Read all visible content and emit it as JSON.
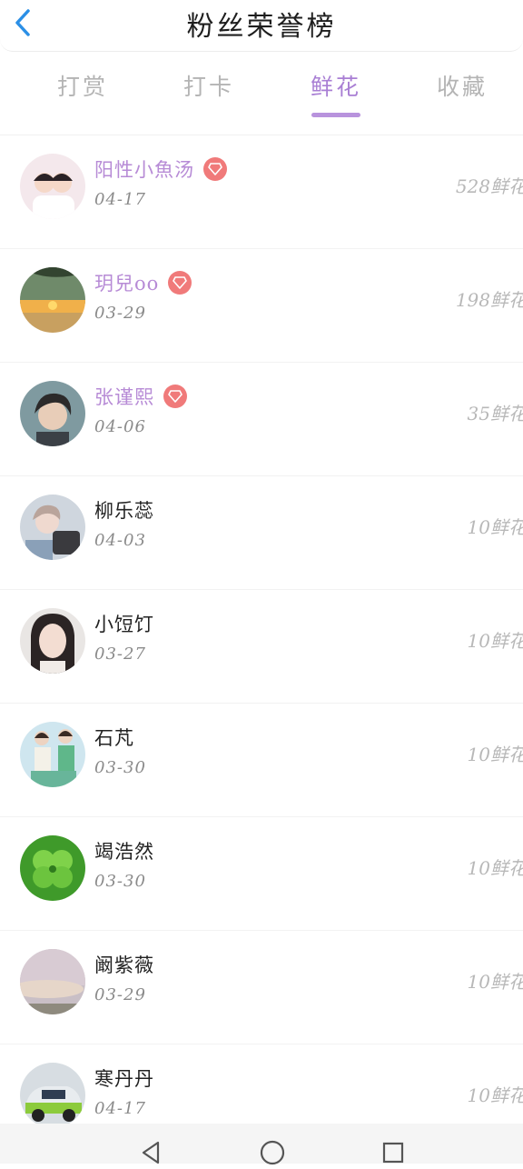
{
  "header": {
    "title": "粉丝荣誉榜",
    "back_icon": "chevron-left-icon",
    "accent": "#2b8fe6"
  },
  "tabs": [
    {
      "label": "打赏",
      "active": false
    },
    {
      "label": "打卡",
      "active": false
    },
    {
      "label": "鲜花",
      "active": true
    },
    {
      "label": "收藏",
      "active": false
    }
  ],
  "colors": {
    "active_tab": "#a97fd4",
    "vip_name": "#b78bd6",
    "badge": "#f07a7a",
    "inactive": "#b4b4b4"
  },
  "rows": [
    {
      "name": "阳性小魚汤",
      "date": "04-17",
      "flowers": "528鲜花",
      "vip": true
    },
    {
      "name": "玥兒oo",
      "date": "03-29",
      "flowers": "198鲜花",
      "vip": true
    },
    {
      "name": "张谨熙",
      "date": "04-06",
      "flowers": "35鲜花",
      "vip": true
    },
    {
      "name": "柳乐蕊",
      "date": "04-03",
      "flowers": "10鲜花",
      "vip": false
    },
    {
      "name": "小饾饤",
      "date": "03-27",
      "flowers": "10鲜花",
      "vip": false
    },
    {
      "name": "石芃",
      "date": "03-30",
      "flowers": "10鲜花",
      "vip": false
    },
    {
      "name": "竭浩然",
      "date": "03-30",
      "flowers": "10鲜花",
      "vip": false
    },
    {
      "name": "阚紫薇",
      "date": "03-29",
      "flowers": "10鲜花",
      "vip": false
    },
    {
      "name": "寒丹丹",
      "date": "04-17",
      "flowers": "10鲜花",
      "vip": false
    }
  ],
  "navbar": {
    "icons": [
      "back-triangle-icon",
      "home-circle-icon",
      "recents-square-icon"
    ]
  }
}
